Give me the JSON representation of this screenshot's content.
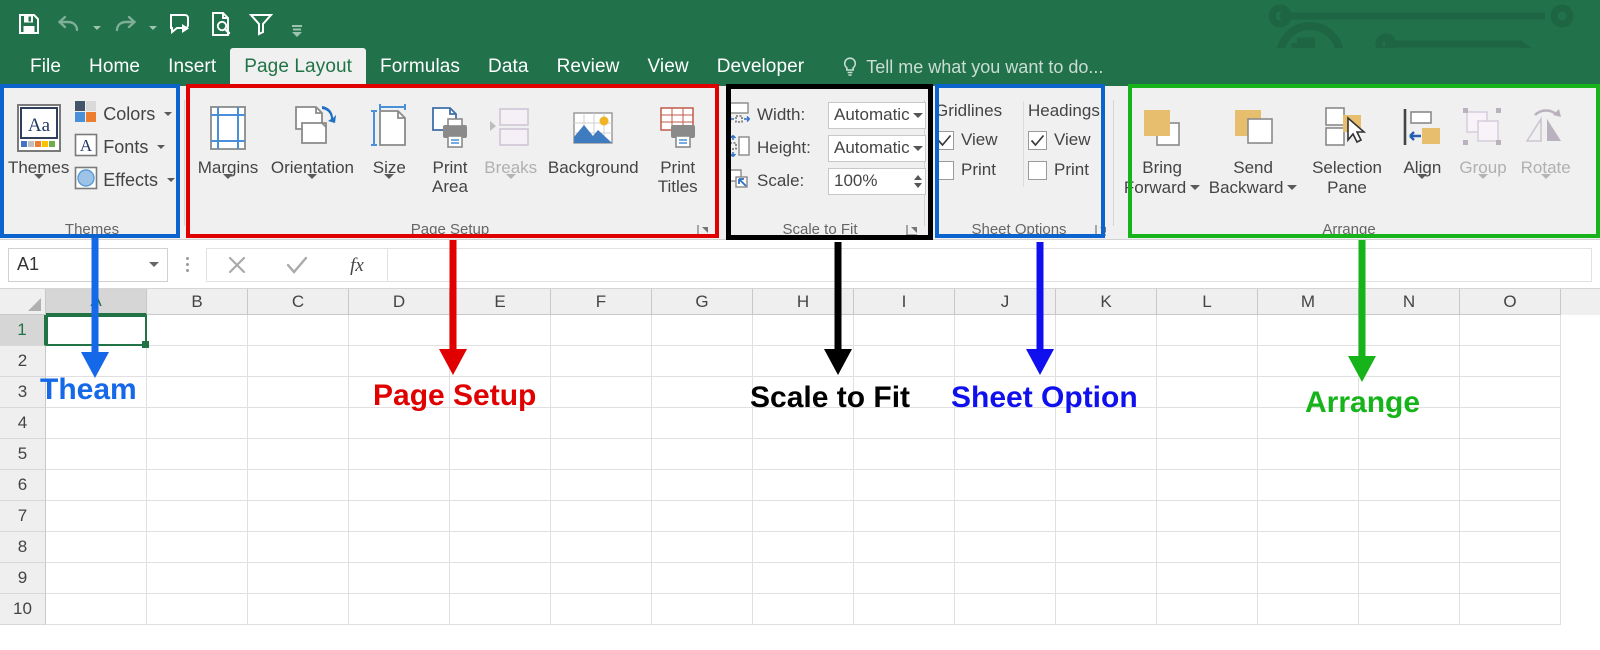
{
  "colors": {
    "ribbon_green": "#21714b",
    "excel_green": "#217346",
    "blue": "#0b63ce",
    "red": "#e00000",
    "black": "#000000",
    "green": "#16b31a",
    "anno_blue": "#1569e8",
    "anno_pure_blue": "#1010ee"
  },
  "quick_access": [
    {
      "name": "save-icon",
      "label": "Save"
    },
    {
      "name": "undo-icon",
      "label": "Undo"
    },
    {
      "name": "redo-icon",
      "label": "Redo"
    },
    {
      "name": "start-inking-icon",
      "label": "Start Inking"
    },
    {
      "name": "print-preview-icon",
      "label": "Print Preview and Print"
    },
    {
      "name": "filter-icon",
      "label": "Filter"
    },
    {
      "name": "customize-qat-icon",
      "label": "Customize Quick Access Toolbar"
    }
  ],
  "tabs": [
    {
      "label": "File",
      "active": false
    },
    {
      "label": "Home",
      "active": false
    },
    {
      "label": "Insert",
      "active": false
    },
    {
      "label": "Page Layout",
      "active": true
    },
    {
      "label": "Formulas",
      "active": false
    },
    {
      "label": "Data",
      "active": false
    },
    {
      "label": "Review",
      "active": false
    },
    {
      "label": "View",
      "active": false
    },
    {
      "label": "Developer",
      "active": false
    }
  ],
  "tell_me": {
    "placeholder": "Tell me what you want to do..."
  },
  "ribbon": {
    "themes": {
      "group_label": "Themes",
      "themes_button": {
        "label": "Themes",
        "icon": "themes-icon"
      },
      "small_buttons": [
        {
          "label": "Colors",
          "icon": "theme-colors-icon"
        },
        {
          "label": "Fonts",
          "icon": "theme-fonts-icon"
        },
        {
          "label": "Effects",
          "icon": "theme-effects-icon"
        }
      ]
    },
    "page_setup": {
      "group_label": "Page Setup",
      "buttons": [
        {
          "label": "Margins",
          "icon": "margins-icon",
          "dropdown": true,
          "disabled": false
        },
        {
          "label": "Orientation",
          "icon": "orientation-icon",
          "dropdown": true,
          "disabled": false
        },
        {
          "label": "Size",
          "icon": "size-icon",
          "dropdown": true,
          "disabled": false
        },
        {
          "label": "Print Area",
          "icon": "print-area-icon",
          "dropdown": true,
          "disabled": false
        },
        {
          "label": "Breaks",
          "icon": "breaks-icon",
          "dropdown": true,
          "disabled": true
        },
        {
          "label": "Background",
          "icon": "background-icon",
          "dropdown": false,
          "disabled": false
        },
        {
          "label": "Print Titles",
          "icon": "print-titles-icon",
          "dropdown": false,
          "disabled": false
        }
      ]
    },
    "scale_to_fit": {
      "group_label": "Scale to Fit",
      "rows": [
        {
          "label": "Width:",
          "value": "Automatic",
          "icon": "width-icon",
          "type": "combo"
        },
        {
          "label": "Height:",
          "value": "Automatic",
          "icon": "height-icon",
          "type": "combo"
        },
        {
          "label": "Scale:",
          "value": "100%",
          "icon": "scale-icon",
          "type": "spinner"
        }
      ]
    },
    "sheet_options": {
      "group_label": "Sheet Options",
      "columns": [
        {
          "header": "Gridlines",
          "checks": [
            {
              "label": "View",
              "checked": true
            },
            {
              "label": "Print",
              "checked": false
            }
          ]
        },
        {
          "header": "Headings",
          "checks": [
            {
              "label": "View",
              "checked": true
            },
            {
              "label": "Print",
              "checked": false
            }
          ]
        }
      ]
    },
    "arrange": {
      "group_label": "Arrange",
      "buttons": [
        {
          "label_line1": "Bring",
          "label_line2": "Forward",
          "icon": "bring-forward-icon",
          "dropdown": true,
          "disabled": false
        },
        {
          "label_line1": "Send",
          "label_line2": "Backward",
          "icon": "send-backward-icon",
          "dropdown": true,
          "disabled": false
        },
        {
          "label_line1": "Selection",
          "label_line2": "Pane",
          "icon": "selection-pane-icon",
          "dropdown": false,
          "disabled": false
        },
        {
          "label_line1": "Align",
          "label_line2": "",
          "icon": "align-icon",
          "dropdown": true,
          "disabled": false
        },
        {
          "label_line1": "Group",
          "label_line2": "",
          "icon": "group-icon",
          "dropdown": true,
          "disabled": true
        },
        {
          "label_line1": "Rotate",
          "label_line2": "",
          "icon": "rotate-icon",
          "dropdown": true,
          "disabled": true
        }
      ]
    }
  },
  "formula_bar": {
    "name_box_value": "A1",
    "cancel_icon": "cancel-icon",
    "enter_icon": "enter-icon",
    "function_icon": "insert-function-icon",
    "formula_value": ""
  },
  "grid": {
    "columns": [
      "A",
      "B",
      "C",
      "D",
      "E",
      "F",
      "G",
      "H",
      "I",
      "J",
      "K",
      "L",
      "M",
      "N",
      "O"
    ],
    "rows": [
      "1",
      "2",
      "3",
      "4",
      "5",
      "6",
      "7",
      "8",
      "9",
      "10"
    ],
    "active_cell": "A1"
  },
  "annotations": [
    {
      "text": "Theam",
      "color": "#1569e8",
      "box_color": "#0b63ce"
    },
    {
      "text": "Page Setup",
      "color": "#e00000",
      "box_color": "#e00000"
    },
    {
      "text": "Scale to Fit",
      "color": "#000000",
      "box_color": "#000000"
    },
    {
      "text": "Sheet Option",
      "color": "#1010ee",
      "box_color": "#0b63ce"
    },
    {
      "text": "Arrange",
      "color": "#16b31a",
      "box_color": "#16b31a"
    }
  ]
}
